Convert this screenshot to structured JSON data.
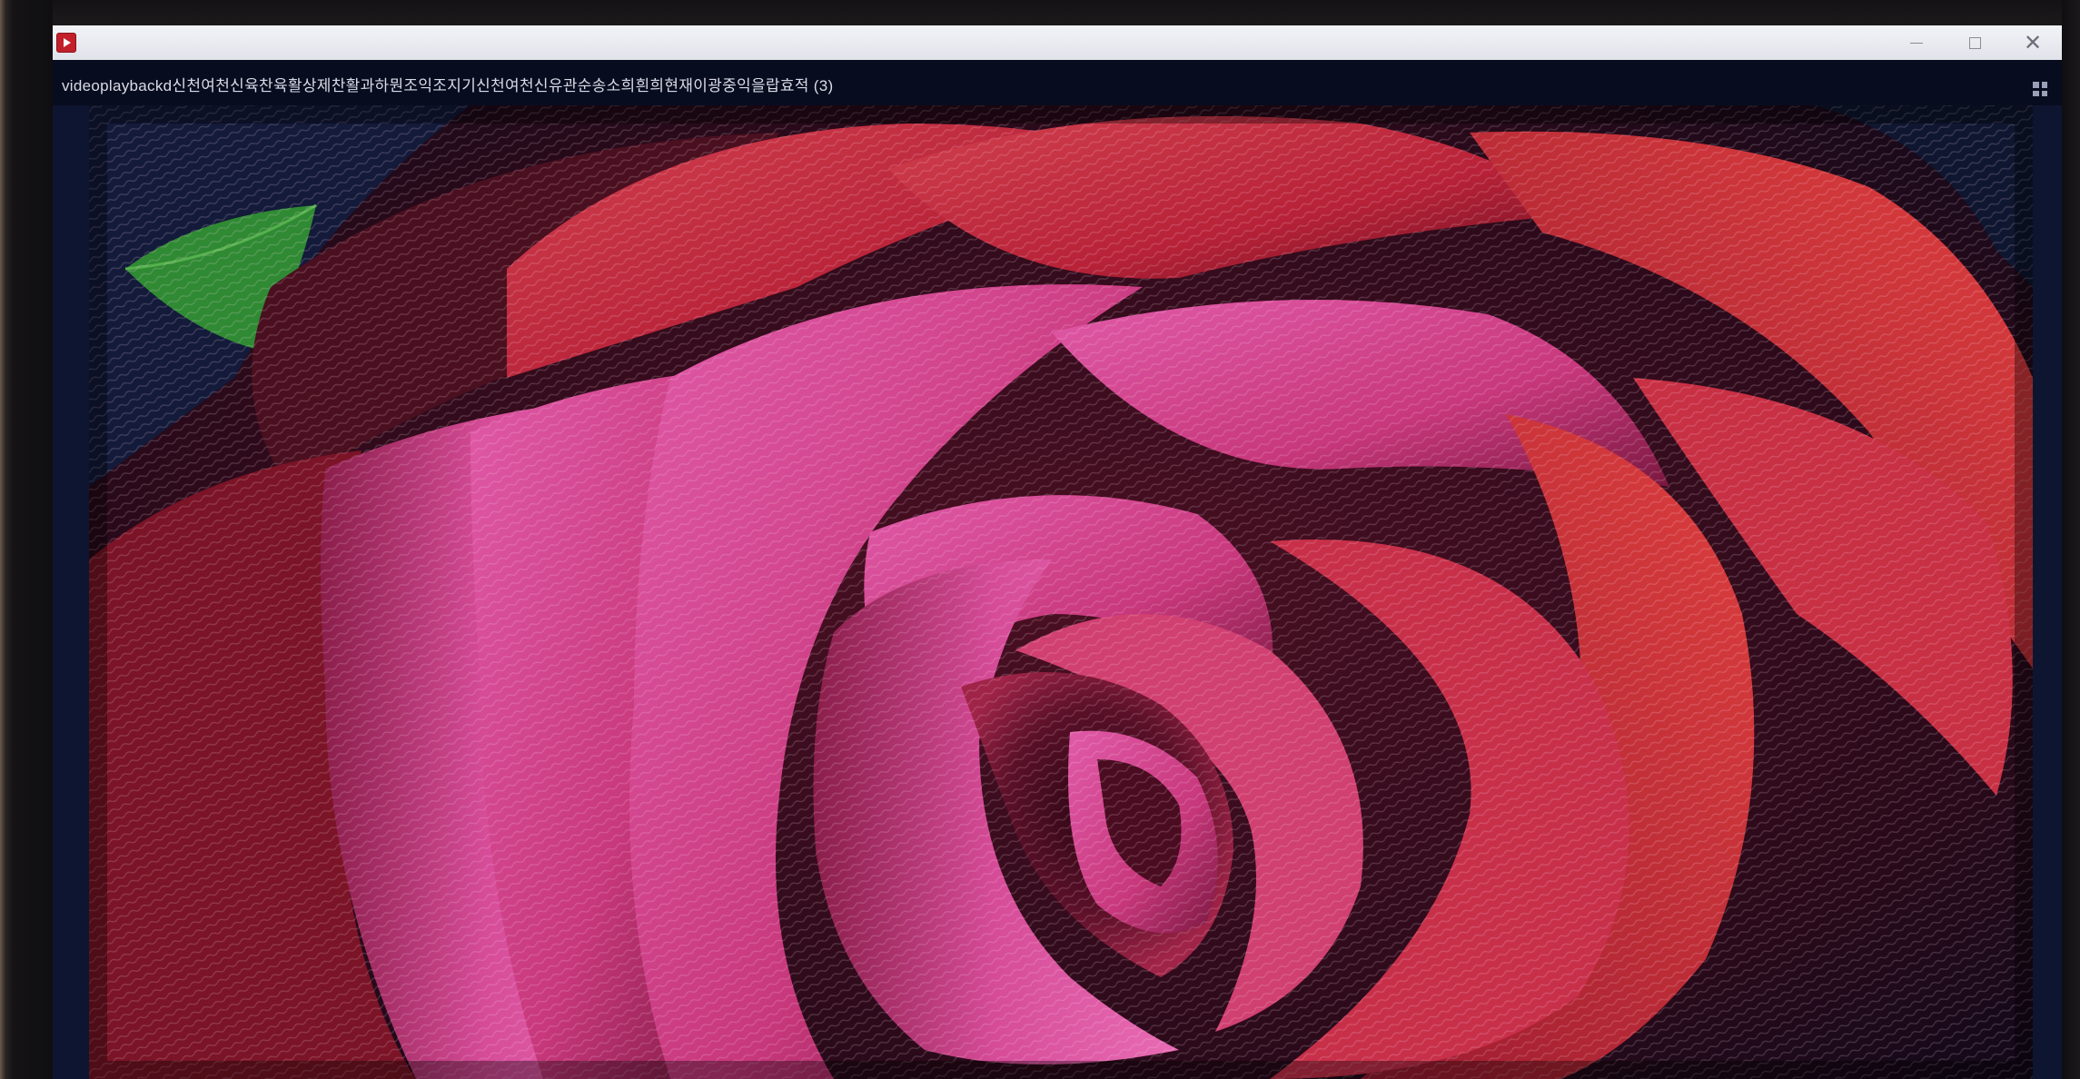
{
  "window": {
    "title": "videoplaybackd신천여천신육찬육활상제찬활과하뭔조익조지기신천여천신유관순송소희흰희현재이광중익을랍효적 (3)",
    "icon": "video-player-icon"
  },
  "controls": {
    "minimize_icon": "minimize-icon",
    "maximize_icon": "maximize-icon",
    "close_icon": "close-icon",
    "close_glyph": "✕"
  },
  "video": {
    "content": "rose-petals-frame",
    "colors": {
      "petal_pink": "#d0448e",
      "petal_red": "#c8283a",
      "shadow": "#3a0a1c",
      "leaf": "#2f8a33",
      "background": "#0e1530"
    }
  }
}
